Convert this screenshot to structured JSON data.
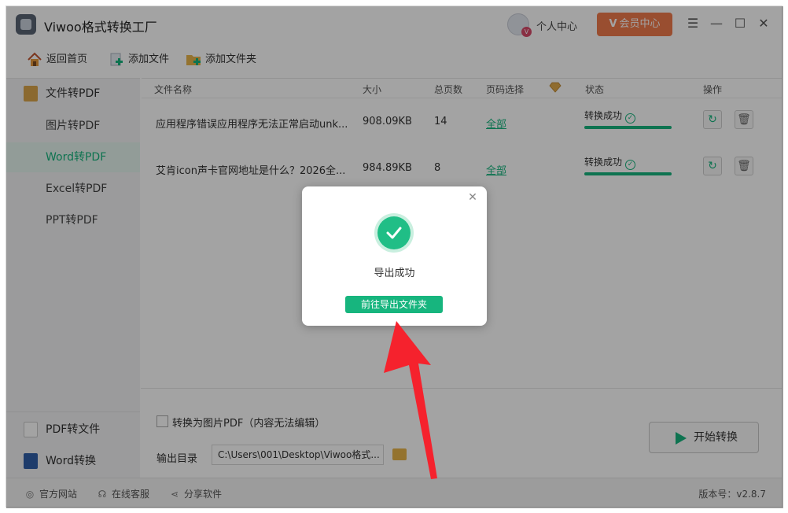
{
  "app": {
    "title": "Viwoo格式转换工厂",
    "user_center": "个人中心",
    "vip_label": "会员中心",
    "vip_badge": "V",
    "window_controls": [
      "menu",
      "minimize",
      "maximize",
      "close"
    ]
  },
  "toolbar": {
    "home": "返回首页",
    "add_file": "添加文件",
    "add_folder": "添加文件夹"
  },
  "sidebar": {
    "category_top": "文件转PDF",
    "items": [
      {
        "label": "图片转PDF",
        "active": false
      },
      {
        "label": "Word转PDF",
        "active": true
      },
      {
        "label": "Excel转PDF",
        "active": false
      },
      {
        "label": "PPT转PDF",
        "active": false
      }
    ],
    "category_pdf": "PDF转文件",
    "category_word": "Word转换"
  },
  "table": {
    "headers": {
      "name": "文件名称",
      "size": "大小",
      "pages": "总页数",
      "range": "页码选择",
      "status": "状态",
      "actions": "操作"
    },
    "rows": [
      {
        "name": "应用程序错误应用程序无法正常启动unk...",
        "size": "908.09KB",
        "pages": "14",
        "range": "全部",
        "status": "转换成功",
        "progress": 1.0
      },
      {
        "name": "艾肯icon声卡官网地址是什么？2026全...",
        "size": "984.89KB",
        "pages": "8",
        "range": "全部",
        "status": "转换成功",
        "progress": 1.0
      }
    ]
  },
  "bottom": {
    "checkbox_label": "转换为图片PDF（内容无法编辑）",
    "checkbox_checked": false,
    "output_label": "输出目录",
    "output_path": "C:\\Users\\001\\Desktop\\Viwoo格式...",
    "start_label": "开始转换"
  },
  "statusbar": {
    "website": "官方网站",
    "service": "在线客服",
    "share": "分享软件",
    "version": "版本号：v2.8.7"
  },
  "dialog": {
    "message": "导出成功",
    "button": "前往导出文件夹"
  },
  "colors": {
    "accent": "#17b57e",
    "vip": "#f07a4c",
    "arrow": "#f5222d"
  }
}
